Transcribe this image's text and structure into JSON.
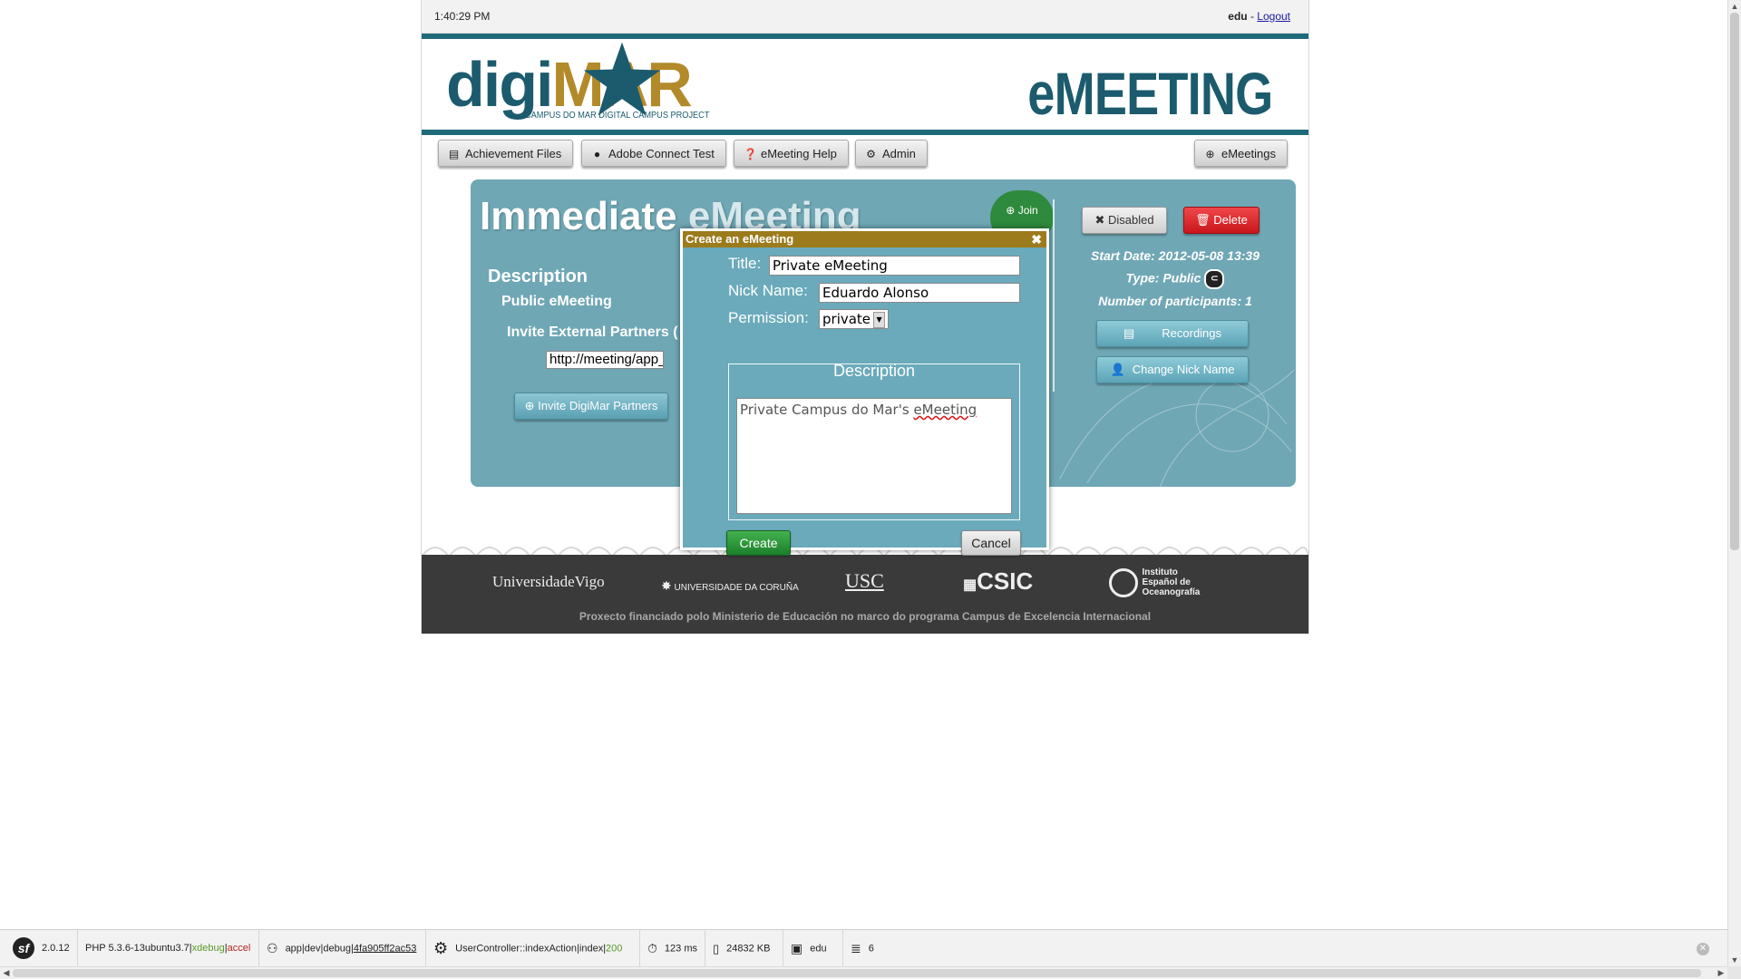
{
  "topbar": {
    "time": "1:40:29 PM",
    "user": "edu",
    "separator": " - ",
    "logout": "Logout"
  },
  "brand": {
    "logo_digi": "digi",
    "logo_mar": "MAR",
    "tagline": "CAMPUS DO MAR DIGITAL CAMPUS  PROJECT",
    "app_name": "eMEETING"
  },
  "nav": {
    "items": [
      {
        "label": "Achievement Files",
        "icon": "document-icon"
      },
      {
        "label": "Adobe Connect Test",
        "icon": "exclamation-icon"
      },
      {
        "label": "eMeeting Help",
        "icon": "question-icon"
      },
      {
        "label": "Admin",
        "icon": "gear-icon"
      }
    ],
    "right": {
      "label": "eMeetings",
      "icon": "plus-circle-icon"
    }
  },
  "meeting": {
    "title_main": "Immediate ",
    "title_light": "eMeeting",
    "join_label": "Join",
    "description_heading": "Description",
    "description_value": "Public eMeeting",
    "invite_external_label": "Invite External Partners (",
    "url_value": "http://meeting/app_d",
    "invite_button": "Invite DigiMar Partners",
    "disabled_button": "Disabled",
    "delete_button": "Delete",
    "start_date": "Start Date: 2012-05-08 13:39",
    "type": "Type: Public",
    "participants": "Number of participants: 1",
    "recordings_button": "Recordings",
    "change_nick_button": "Change Nick Name"
  },
  "footer": {
    "logos": [
      "UniversidadeVigo",
      "UNIVERSIDADE DA CORUÑA",
      "USC",
      "CSIC",
      "Instituto Español de Oceanografía"
    ],
    "credit": "Proxecto financiado polo Ministerio de Educación no marco do programa Campus de Excelencia Internacional"
  },
  "dialog": {
    "title": "Create an eMeeting",
    "close": "✖",
    "title_label": "Title:",
    "title_value": "Private eMeeting",
    "nick_label": "Nick Name:",
    "nick_value": "Eduardo Alonso",
    "permission_label": "Permission:",
    "permission_value": "private",
    "description_legend": "Description",
    "description_text": "Private Campus do Mar's ",
    "description_misspelled": "eMeeting",
    "create_button": "Create",
    "cancel_button": "Cancel"
  },
  "debug_toolbar": {
    "version": "2.0.12",
    "php": "PHP 5.3.6-13ubuntu3.7",
    "php_ext_ok": "xdebug",
    "php_ext_bad": "accel",
    "app": "app",
    "env": "dev",
    "debug": "debug",
    "token": "4fa905ff2ac53",
    "controller": "UserController::indexAction",
    "route": "index",
    "status": "200",
    "time": "123 ms",
    "memory": "24832 KB",
    "user": "edu",
    "queries": "6"
  },
  "colors": {
    "teal": "#1f6a7a",
    "gold": "#b38a2a",
    "panel": "#6fa7b5",
    "dialog_header": "#9c7b1c",
    "create_green": "#1c7f2a",
    "delete_red": "#c8161b"
  }
}
